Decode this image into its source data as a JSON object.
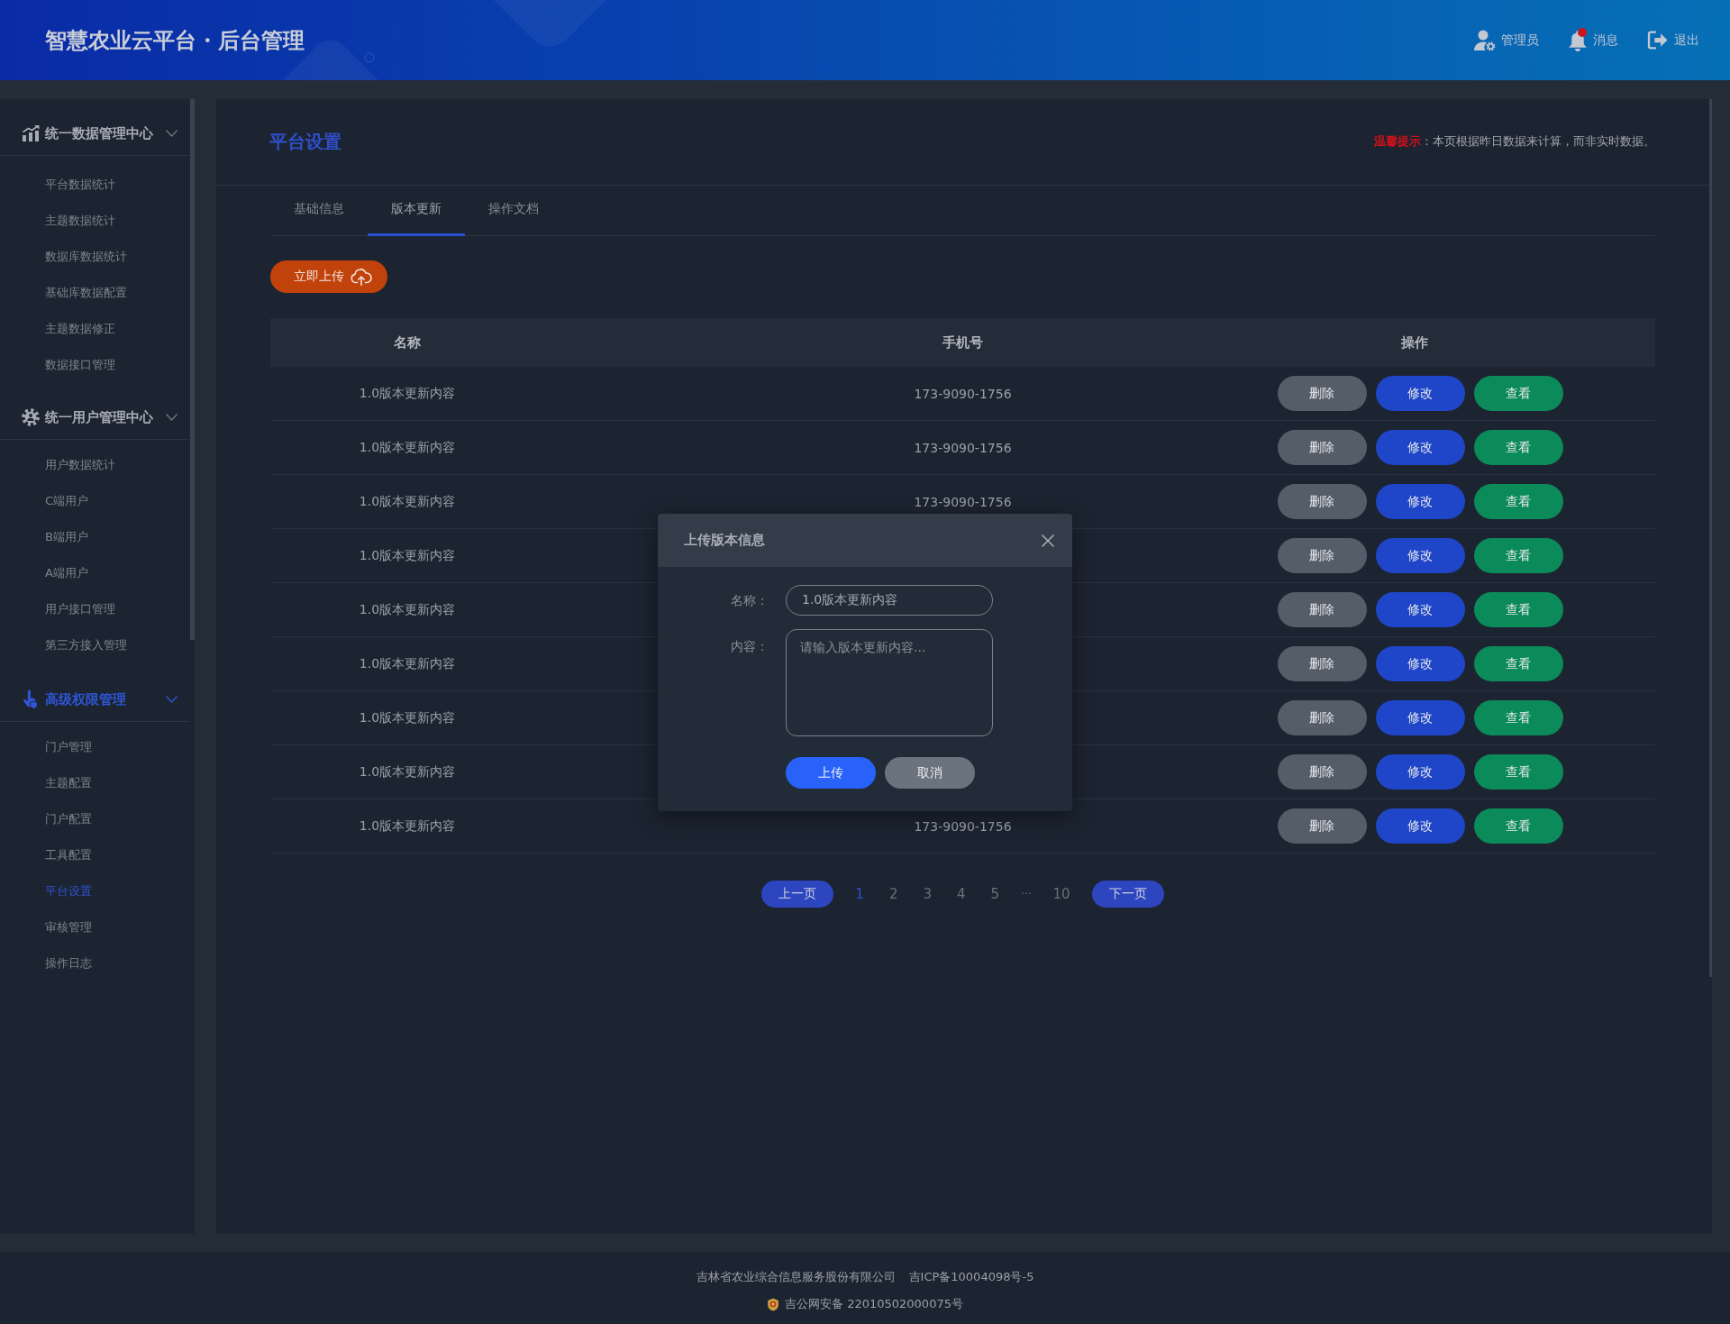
{
  "header": {
    "title": "智慧农业云平台・后台管理",
    "account": {
      "label": "管理员"
    },
    "messages": {
      "label": "消息",
      "unread": true
    },
    "logout": {
      "label": "退出"
    }
  },
  "sidebar": {
    "groups": [
      {
        "title": "统一数据管理中心",
        "selected": false,
        "expanded": true,
        "items": [
          {
            "label": "平台数据统计",
            "selected": false
          },
          {
            "label": "主题数据统计",
            "selected": false
          },
          {
            "label": "数据库数据统计",
            "selected": false
          },
          {
            "label": "基础库数据配置",
            "selected": false
          },
          {
            "label": "主题数据修正",
            "selected": false
          },
          {
            "label": "数据接口管理",
            "selected": false
          }
        ]
      },
      {
        "title": "统一用户管理中心",
        "selected": false,
        "expanded": true,
        "items": [
          {
            "label": "用户数据统计",
            "selected": false
          },
          {
            "label": "C端用户",
            "selected": false
          },
          {
            "label": "B端用户",
            "selected": false
          },
          {
            "label": "A端用户",
            "selected": false
          },
          {
            "label": "用户接口管理",
            "selected": false
          },
          {
            "label": "第三方接入管理",
            "selected": false
          }
        ]
      },
      {
        "title": "高级权限管理",
        "selected": true,
        "expanded": true,
        "items": [
          {
            "label": "门户管理",
            "selected": false
          },
          {
            "label": "主题配置",
            "selected": false
          },
          {
            "label": "门户配置",
            "selected": false
          },
          {
            "label": "工具配置",
            "selected": false
          },
          {
            "label": "平台设置",
            "selected": true
          },
          {
            "label": "审核管理",
            "selected": false
          },
          {
            "label": "操作日志",
            "selected": false
          }
        ]
      }
    ]
  },
  "page": {
    "title": "平台设置",
    "notice": "**温馨提示**：本页根据昨日数据来计算，而非实时数据。",
    "tabs": [
      {
        "label": "基础信息",
        "selected": false
      },
      {
        "label": "版本更新",
        "selected": true
      },
      {
        "label": "操作文档",
        "selected": false
      }
    ],
    "upload_button": {
      "label": "立即上传"
    },
    "table": {
      "columns": [
        "名称",
        "手机号",
        "操作"
      ],
      "rows": [
        {
          "name": "1.0版本更新内容",
          "phone": "173-9090-1756",
          "actions": [
            {
              "kind": "delete",
              "label": "删除"
            },
            {
              "kind": "edit",
              "label": "修改"
            },
            {
              "kind": "view",
              "label": "查看"
            }
          ]
        },
        {
          "name": "1.0版本更新内容",
          "phone": "173-9090-1756",
          "actions": [
            {
              "kind": "delete",
              "label": "删除"
            },
            {
              "kind": "edit",
              "label": "修改"
            },
            {
              "kind": "view",
              "label": "查看"
            }
          ]
        },
        {
          "name": "1.0版本更新内容",
          "phone": "173-9090-1756",
          "actions": [
            {
              "kind": "delete",
              "label": "删除"
            },
            {
              "kind": "edit",
              "label": "修改"
            },
            {
              "kind": "view",
              "label": "查看"
            }
          ]
        },
        {
          "name": "1.0版本更新内容",
          "actions": [
            {
              "kind": "delete",
              "label": "删除"
            },
            {
              "kind": "edit",
              "label": "修改"
            },
            {
              "kind": "view",
              "label": "查看"
            }
          ]
        },
        {
          "name": "1.0版本更新内容",
          "actions": [
            {
              "kind": "delete",
              "label": "删除"
            },
            {
              "kind": "edit",
              "label": "修改"
            },
            {
              "kind": "view",
              "label": "查看"
            }
          ]
        },
        {
          "name": "1.0版本更新内容",
          "actions": [
            {
              "kind": "delete",
              "label": "删除"
            },
            {
              "kind": "edit",
              "label": "修改"
            },
            {
              "kind": "view",
              "label": "查看"
            }
          ]
        },
        {
          "name": "1.0版本更新内容",
          "actions": [
            {
              "kind": "delete",
              "label": "删除"
            },
            {
              "kind": "edit",
              "label": "修改"
            },
            {
              "kind": "view",
              "label": "查看"
            }
          ]
        },
        {
          "name": "1.0版本更新内容",
          "actions": [
            {
              "kind": "delete",
              "label": "删除"
            },
            {
              "kind": "edit",
              "label": "修改"
            },
            {
              "kind": "view",
              "label": "查看"
            }
          ]
        },
        {
          "name": "1.0版本更新内容",
          "phone": "173-9090-1756",
          "actions": [
            {
              "kind": "delete",
              "label": "删除"
            },
            {
              "kind": "edit",
              "label": "修改"
            },
            {
              "kind": "view",
              "label": "查看"
            }
          ]
        }
      ]
    },
    "pagination": {
      "previous": "上一页",
      "pages": [
        {
          "kind": "page",
          "label": "1",
          "selected": true
        },
        {
          "kind": "page",
          "label": "2",
          "selected": false
        },
        {
          "kind": "page",
          "label": "3",
          "selected": false
        },
        {
          "kind": "page",
          "label": "4",
          "selected": false
        },
        {
          "kind": "page",
          "label": "5",
          "selected": false
        },
        {
          "kind": "ellipsis",
          "label": "···",
          "selected": false
        },
        {
          "kind": "page",
          "label": "10",
          "selected": false
        }
      ],
      "next": "下一页"
    }
  },
  "modal": {
    "title": "上传版本信息",
    "fields": [
      {
        "kind": "text",
        "label": "名称：",
        "value": "1.0版本更新内容"
      },
      {
        "kind": "textarea",
        "label": "内容：",
        "placeholder": "请输入版本更新内容..."
      }
    ],
    "buttons": [
      {
        "kind": "primary",
        "label": "上传"
      },
      {
        "kind": "secondary",
        "label": "取消"
      }
    ]
  },
  "footer": {
    "company": "吉林省农业综合信息服务股份有限公司",
    "icp": "吉ICP备10004098号-5",
    "police_record": "吉公网安备 22010502000075号"
  }
}
